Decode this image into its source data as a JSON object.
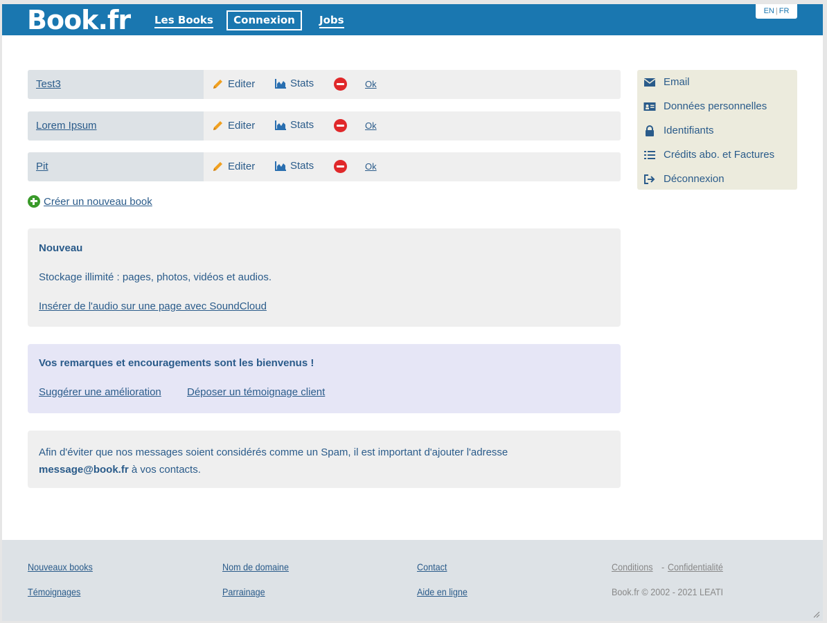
{
  "header": {
    "logo": "Book.fr",
    "nav": {
      "books": "Les Books",
      "login": "Connexion",
      "jobs": "Jobs"
    },
    "lang": {
      "en": "EN",
      "sep": "|",
      "fr": "FR"
    }
  },
  "books": [
    {
      "name": "Test3"
    },
    {
      "name": "Lorem Ipsum"
    },
    {
      "name": "Pit"
    }
  ],
  "actions": {
    "edit": "Editer",
    "stats": "Stats",
    "ok": "Ok"
  },
  "create_label": "Créer un nouveau book",
  "news": {
    "title": "Nouveau",
    "line": "Stockage illimité : pages, photos, vidéos et audios.",
    "link": "Insérer de l'audio sur une page avec SoundCloud"
  },
  "feedback": {
    "title": "Vos remarques et encouragements sont les bienvenus !",
    "suggest": "Suggérer une amélioration",
    "testimonial": "Déposer un témoignage client"
  },
  "spam": {
    "text_before": "Afin d'éviter que nos messages soient considérés comme un Spam, il est important d'ajouter l'adresse",
    "email": "message@book.fr",
    "text_after": " à vos contacts."
  },
  "account_menu": [
    {
      "label": "Email",
      "icon": "envelope-icon"
    },
    {
      "label": "Données personnelles",
      "icon": "id-card-icon"
    },
    {
      "label": "Identifiants",
      "icon": "lock-icon"
    },
    {
      "label": "Crédits abo. et Factures",
      "icon": "list-icon"
    },
    {
      "label": "Déconnexion",
      "icon": "logout-icon"
    }
  ],
  "footer": {
    "new_books": "Nouveaux books",
    "testimonials": "Témoignages",
    "domain": "Nom de domaine",
    "referral": "Parrainage",
    "contact": "Contact",
    "help": "Aide en ligne",
    "conditions": "Conditions",
    "dash": "-",
    "privacy": "Confidentialité",
    "copyright": "Book.fr © 2002 - 2021 LEATI"
  },
  "colors": {
    "header_blue": "#1a77b0",
    "text_blue": "#2a5b8a",
    "delete_red": "#e0282a",
    "create_green": "#3a9a2a",
    "pencil_orange": "#f0a020"
  }
}
